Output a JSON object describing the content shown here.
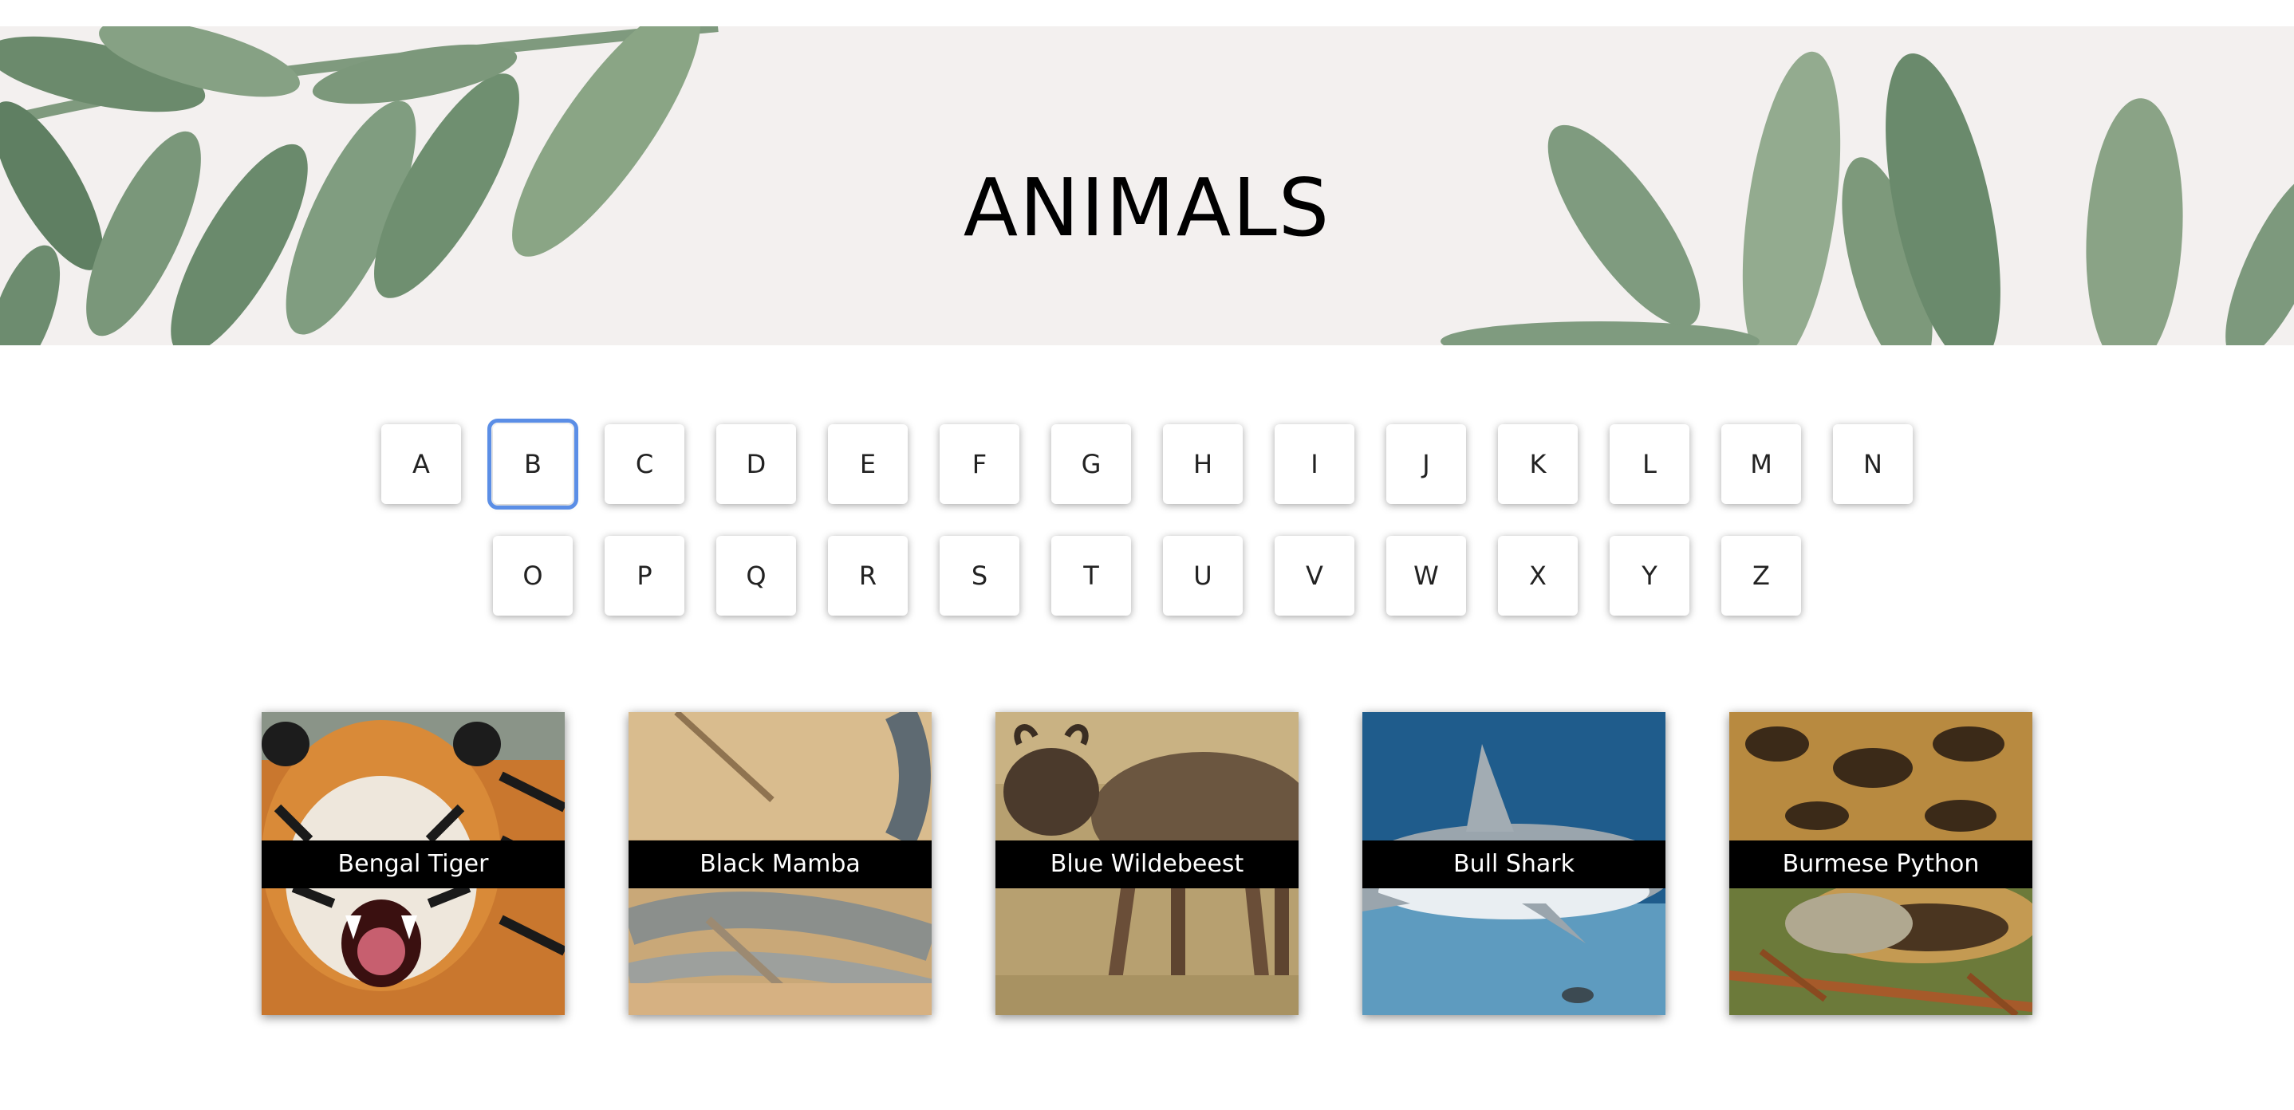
{
  "banner": {
    "title": "ANIMALS",
    "background_color": "#f3f0ef",
    "decoration": "watercolor-leaves"
  },
  "alphabet": {
    "row1": [
      "A",
      "B",
      "C",
      "D",
      "E",
      "F",
      "G",
      "H",
      "I",
      "J",
      "K",
      "L",
      "M",
      "N"
    ],
    "row2": [
      "O",
      "P",
      "Q",
      "R",
      "S",
      "T",
      "U",
      "V",
      "W",
      "X",
      "Y",
      "Z"
    ],
    "selected": "B",
    "focus_color": "#5b8ee6"
  },
  "animals": [
    {
      "name": "Bengal Tiger",
      "image": "tiger-photo"
    },
    {
      "name": "Black Mamba",
      "image": "snake-photo"
    },
    {
      "name": "Blue Wildebeest",
      "image": "wildebeest-photo"
    },
    {
      "name": "Bull Shark",
      "image": "shark-photo"
    },
    {
      "name": "Burmese Python",
      "image": "python-photo"
    }
  ]
}
